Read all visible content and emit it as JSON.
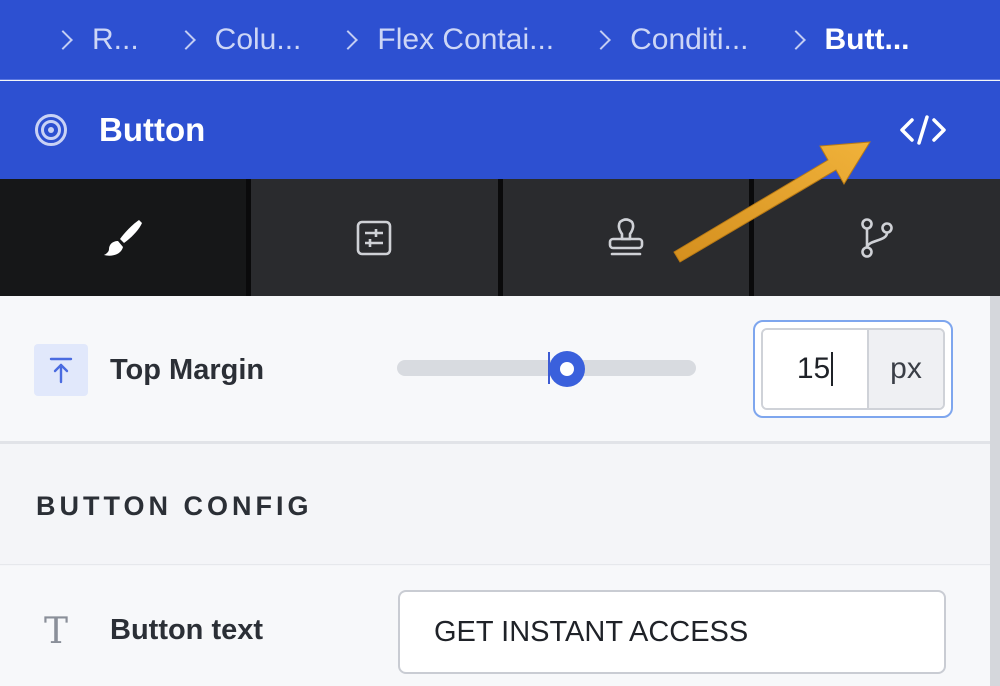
{
  "breadcrumb": {
    "items": [
      "R...",
      "Colu...",
      "Flex Contai...",
      "Conditi...",
      "Butt..."
    ]
  },
  "header": {
    "title": "Button",
    "target_icon": "target-icon",
    "code_icon": "code-icon"
  },
  "tabs": [
    {
      "icon": "paintbrush-icon",
      "active": true
    },
    {
      "icon": "sliders-icon",
      "active": false
    },
    {
      "icon": "stamp-icon",
      "active": false
    },
    {
      "icon": "git-branch-icon",
      "active": false
    }
  ],
  "top_margin": {
    "label": "Top Margin",
    "icon": "align-top-icon",
    "value": "15",
    "unit": "px"
  },
  "section": {
    "title": "BUTTON CONFIG"
  },
  "button_text": {
    "label": "Button text",
    "icon": "text-icon",
    "value": "GET INSTANT ACCESS"
  },
  "colors": {
    "header_blue": "#2d50d1",
    "accent_blue": "#3a60dc",
    "arrow_gold": "#e6a12b"
  }
}
